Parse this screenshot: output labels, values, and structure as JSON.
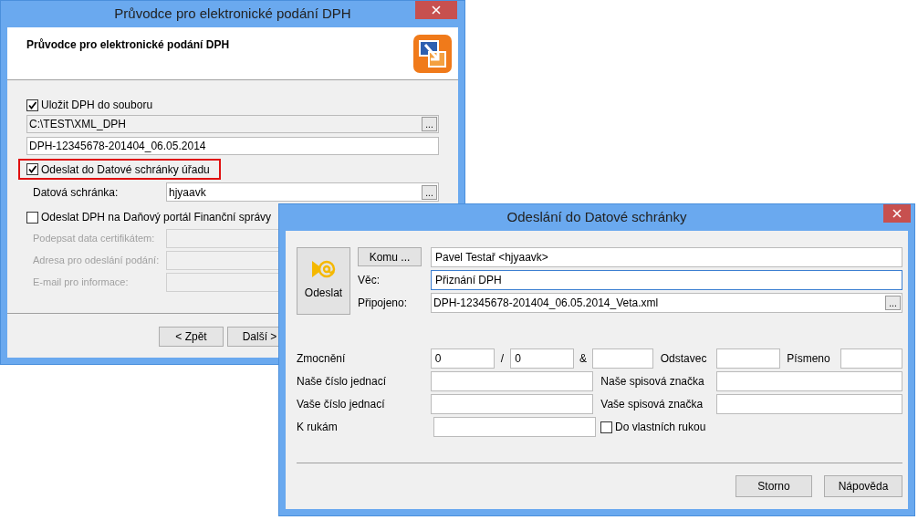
{
  "wizard": {
    "title": "Průvodce pro elektronické podání DPH",
    "header_title": "Průvodce pro elektronické podání DPH",
    "save_to_file": {
      "label": "Uložit DPH do souboru",
      "checked": true
    },
    "folder": {
      "value": "C:\\TEST\\XML_DPH",
      "browse": "..."
    },
    "filename": "DPH-12345678-201404_06.05.2014",
    "send_databox": {
      "label": "Odeslat do Datové schránky úřadu",
      "checked": true,
      "highlighted": true
    },
    "databox": {
      "label": "Datová schránka:",
      "value": "hjyaavk",
      "browse": "..."
    },
    "send_portal": {
      "label": "Odeslat DPH na Daňový portál Finanční správy",
      "checked": false
    },
    "portal_fields": [
      {
        "label": "Podepsat data certifikátem:",
        "disabled": true
      },
      {
        "label": "Adresa pro odeslání podání:",
        "disabled": true
      },
      {
        "label": "E-mail pro informace:",
        "disabled": true
      }
    ],
    "buttons": [
      {
        "label": "< Zpět"
      },
      {
        "label": "Další >"
      }
    ]
  },
  "dialog": {
    "title": "Odeslání do Datové schránky",
    "send_button": "Odeslat",
    "to_button": "Komu ...",
    "to_value": "Pavel Testař <hjyaavk>",
    "subject": {
      "label": "Věc:",
      "value": "Přiznání DPH",
      "focused": true
    },
    "attached": {
      "label": "Připojeno:",
      "value": "DPH-12345678-201404_06.05.2014_Veta.xml",
      "browse": "..."
    },
    "authorization": {
      "label": "Zmocnění",
      "number": "0",
      "separator_1": "/",
      "year": "0",
      "separator_2": "&",
      "paragraph_label": "Odstavec",
      "letter_label": "Písmeno"
    },
    "rows": [
      {
        "label": "Naše číslo jednací",
        "right_label": "Naše spisová značka"
      },
      {
        "label": "Vaše číslo jednací",
        "right_label": "Vaše spisová značka"
      },
      {
        "label": "K rukám",
        "checkbox": {
          "label": "Do vlastních rukou",
          "checked": false
        }
      }
    ],
    "buttons": [
      {
        "label": "Storno"
      },
      {
        "label": "Nápověda"
      }
    ]
  }
}
